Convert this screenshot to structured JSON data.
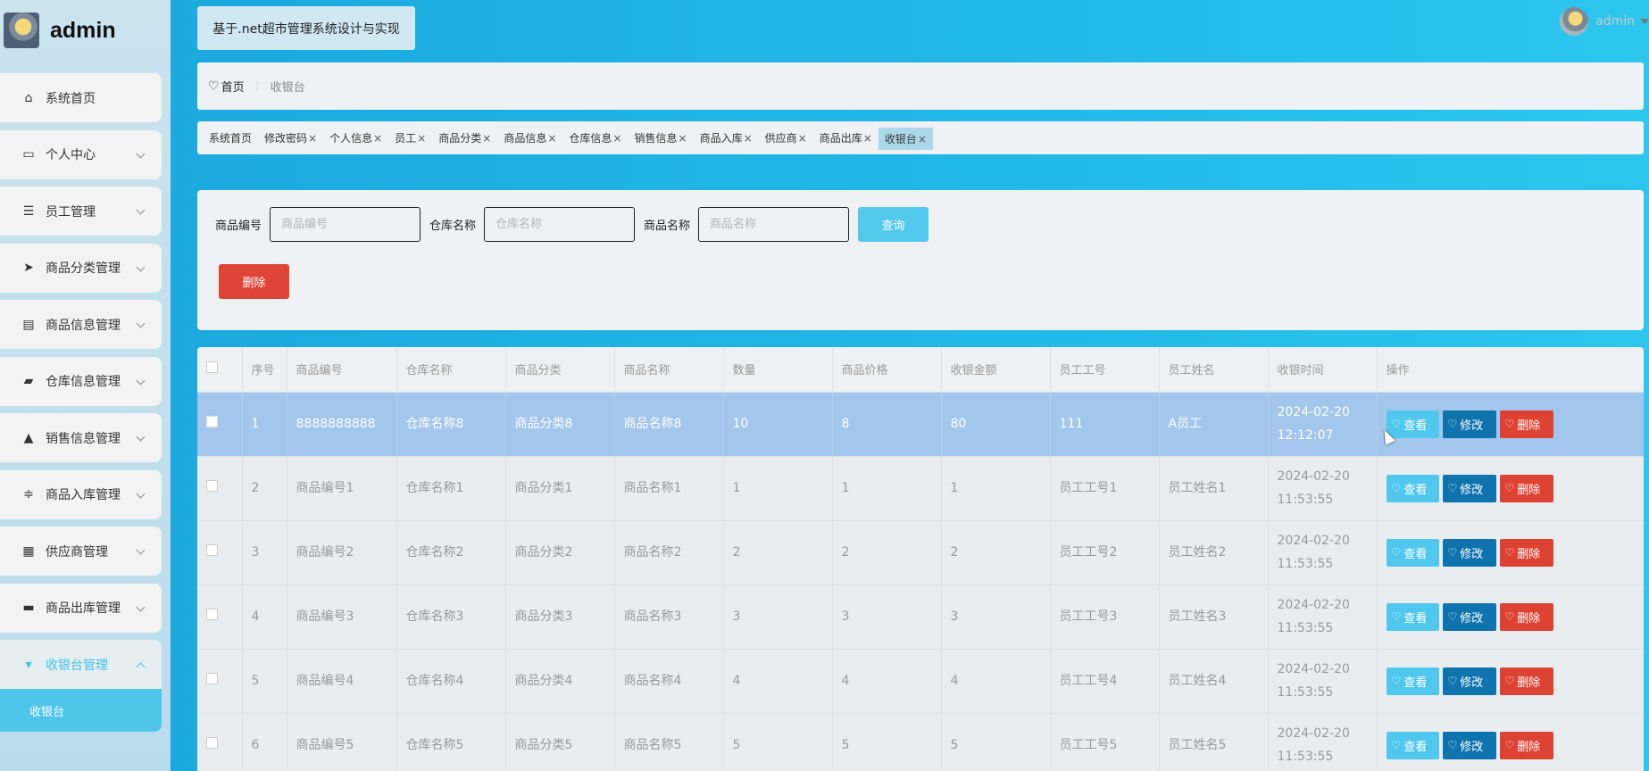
{
  "brand": {
    "name": "admin"
  },
  "system_title": "基于.net超市管理系统设计与实现",
  "user": {
    "name": "admin"
  },
  "sidebar": {
    "items": [
      {
        "label": "系统首页",
        "icon": "home-icon",
        "has_children": false
      },
      {
        "label": "个人中心",
        "icon": "profile-icon",
        "has_children": true
      },
      {
        "label": "员工管理",
        "icon": "list-icon",
        "has_children": true
      },
      {
        "label": "商品分类管理",
        "icon": "send-icon",
        "has_children": true
      },
      {
        "label": "商品信息管理",
        "icon": "clipboard-icon",
        "has_children": true
      },
      {
        "label": "仓库信息管理",
        "icon": "ticket-icon",
        "has_children": true
      },
      {
        "label": "销售信息管理",
        "icon": "user-icon",
        "has_children": true
      },
      {
        "label": "商品入库管理",
        "icon": "sliders-icon",
        "has_children": true
      },
      {
        "label": "供应商管理",
        "icon": "grid-icon",
        "has_children": true
      },
      {
        "label": "商品出库管理",
        "icon": "monitor-icon",
        "has_children": true
      },
      {
        "label": "收银台管理",
        "icon": "cashier-icon",
        "has_children": true,
        "active": true
      }
    ],
    "submenu": [
      {
        "label": "收银台"
      }
    ]
  },
  "breadcrumb": {
    "home": "首页",
    "separator": "⋮",
    "current": "收银台"
  },
  "tags": [
    {
      "label": "系统首页",
      "closable": false
    },
    {
      "label": "修改密码",
      "closable": true
    },
    {
      "label": "个人信息",
      "closable": true
    },
    {
      "label": "员工",
      "closable": true
    },
    {
      "label": "商品分类",
      "closable": true
    },
    {
      "label": "商品信息",
      "closable": true
    },
    {
      "label": "仓库信息",
      "closable": true
    },
    {
      "label": "销售信息",
      "closable": true
    },
    {
      "label": "商品入库",
      "closable": true
    },
    {
      "label": "供应商",
      "closable": true
    },
    {
      "label": "商品出库",
      "closable": true
    },
    {
      "label": "收银台",
      "closable": true,
      "active": true
    }
  ],
  "search": {
    "fields": [
      {
        "label": "商品编号",
        "placeholder": "商品编号",
        "value": ""
      },
      {
        "label": "仓库名称",
        "placeholder": "仓库名称",
        "value": ""
      },
      {
        "label": "商品名称",
        "placeholder": "商品名称",
        "value": ""
      }
    ],
    "query_label": "查询",
    "delete_label": "删除"
  },
  "table": {
    "columns": [
      "序号",
      "商品编号",
      "仓库名称",
      "商品分类",
      "商品名称",
      "数量",
      "商品价格",
      "收银金额",
      "员工工号",
      "员工姓名",
      "收银时间",
      "操作"
    ],
    "rows": [
      [
        "1",
        "8888888888",
        "仓库名称8",
        "商品分类8",
        "商品名称8",
        "10",
        "8",
        "80",
        "111",
        "A员工",
        "2024-02-20 12:12:07"
      ],
      [
        "2",
        "商品编号1",
        "仓库名称1",
        "商品分类1",
        "商品名称1",
        "1",
        "1",
        "1",
        "员工工号1",
        "员工姓名1",
        "2024-02-20 11:53:55"
      ],
      [
        "3",
        "商品编号2",
        "仓库名称2",
        "商品分类2",
        "商品名称2",
        "2",
        "2",
        "2",
        "员工工号2",
        "员工姓名2",
        "2024-02-20 11:53:55"
      ],
      [
        "4",
        "商品编号3",
        "仓库名称3",
        "商品分类3",
        "商品名称3",
        "3",
        "3",
        "3",
        "员工工号3",
        "员工姓名3",
        "2024-02-20 11:53:55"
      ],
      [
        "5",
        "商品编号4",
        "仓库名称4",
        "商品分类4",
        "商品名称4",
        "4",
        "4",
        "4",
        "员工工号4",
        "员工姓名4",
        "2024-02-20 11:53:55"
      ],
      [
        "6",
        "商品编号5",
        "仓库名称5",
        "商品分类5",
        "商品名称5",
        "5",
        "5",
        "5",
        "员工工号5",
        "员工姓名5",
        "2024-02-20 11:53:55"
      ]
    ],
    "selected_row": 0,
    "actions": {
      "view": "查看",
      "edit": "修改",
      "delete": "删除"
    }
  },
  "colors": {
    "accent": "#54c9ee",
    "danger": "#de4536",
    "edit": "#0f73ad",
    "selected_row": "#a3c6ec"
  }
}
